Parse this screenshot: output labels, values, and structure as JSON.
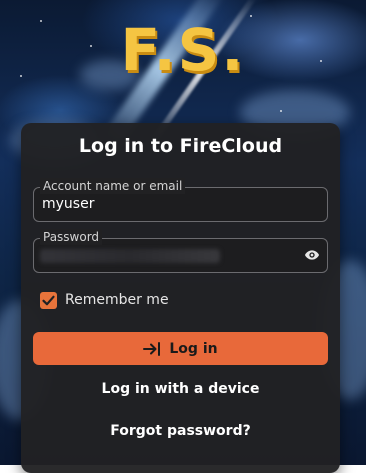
{
  "logo": {
    "text": "F.S."
  },
  "login": {
    "title": "Log in to FireCloud",
    "account_field": {
      "label": "Account name or email",
      "value": "myuser"
    },
    "password_field": {
      "label": "Password"
    },
    "remember": {
      "label": "Remember me",
      "checked": true
    },
    "login_button": {
      "label": "Log in"
    },
    "device_link": "Log in with a device",
    "forgot_link": "Forgot password?"
  },
  "colors": {
    "accent": "#e8693a",
    "card_bg": "#212123",
    "logo": "#f5c542"
  },
  "icons": {
    "password_toggle": "eye-icon",
    "login_button": "arrow-right-to-bracket-icon",
    "checkbox": "check-icon"
  }
}
